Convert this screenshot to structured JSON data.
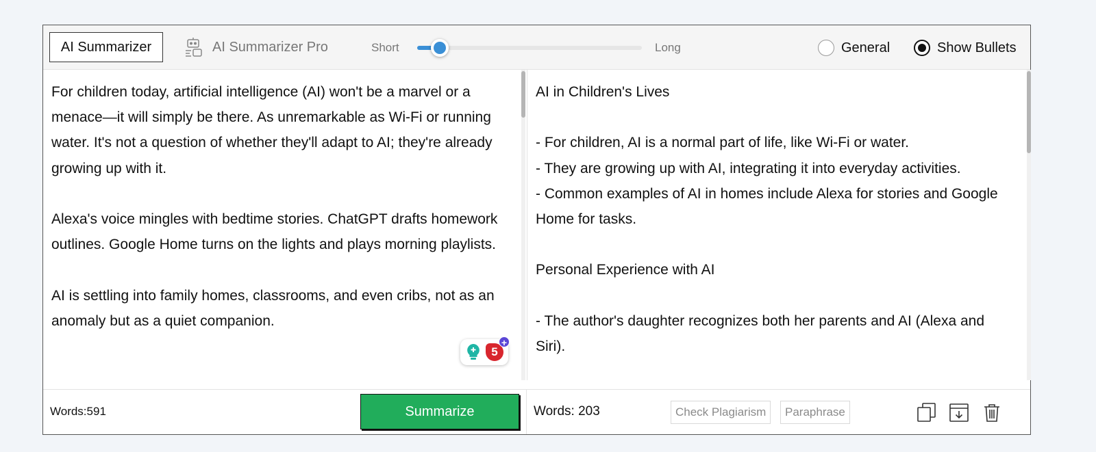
{
  "toolbar": {
    "tab_basic": "AI Summarizer",
    "tab_pro": "AI Summarizer Pro",
    "length_short": "Short",
    "length_long": "Long",
    "length_level": 0.1,
    "mode_general": "General",
    "mode_bullets": "Show Bullets",
    "selected_mode": "Show Bullets"
  },
  "input": {
    "text": "For children today, artificial intelligence (AI) won't be a marvel or a menace—it will simply be there. As unremarkable as Wi-Fi or running water. It's not a question of whether they'll adapt to AI; they're already growing up with it.\n\nAlexa's voice mingles with bedtime stories. ChatGPT drafts homework outlines. Google Home turns on the lights and plays morning playlists.\n\nAI is settling into family homes, classrooms, and even cribs, not as an anomaly but as a quiet companion.",
    "word_count": "Words:591",
    "summarize_label": "Summarize",
    "extension_count": "5",
    "extension_plus": "+"
  },
  "output": {
    "text": "AI in Children's Lives\n\n- For children, AI is a normal part of life, like Wi-Fi or water.\n- They are growing up with AI, integrating it into everyday activities.\n- Common examples of AI in homes include Alexa for stories and Google Home for tasks.\n\nPersonal Experience with AI\n\n- The author's daughter recognizes both her parents and AI (Alexa and Siri).",
    "word_count": "Words: 203",
    "check_plagiarism_label": "Check Plagiarism",
    "paraphrase_label": "Paraphrase"
  },
  "colors": {
    "accent": "#3a8fd6",
    "summarize": "#21ad5b",
    "badge_red": "#d8262e",
    "badge_purple": "#5b47d6",
    "bulb_teal": "#1fb5a5"
  },
  "icons": {
    "pro": "robot-icon",
    "copy": "copy-icon",
    "download": "download-icon",
    "trash": "trash-icon",
    "bulb": "lightbulb-icon"
  }
}
